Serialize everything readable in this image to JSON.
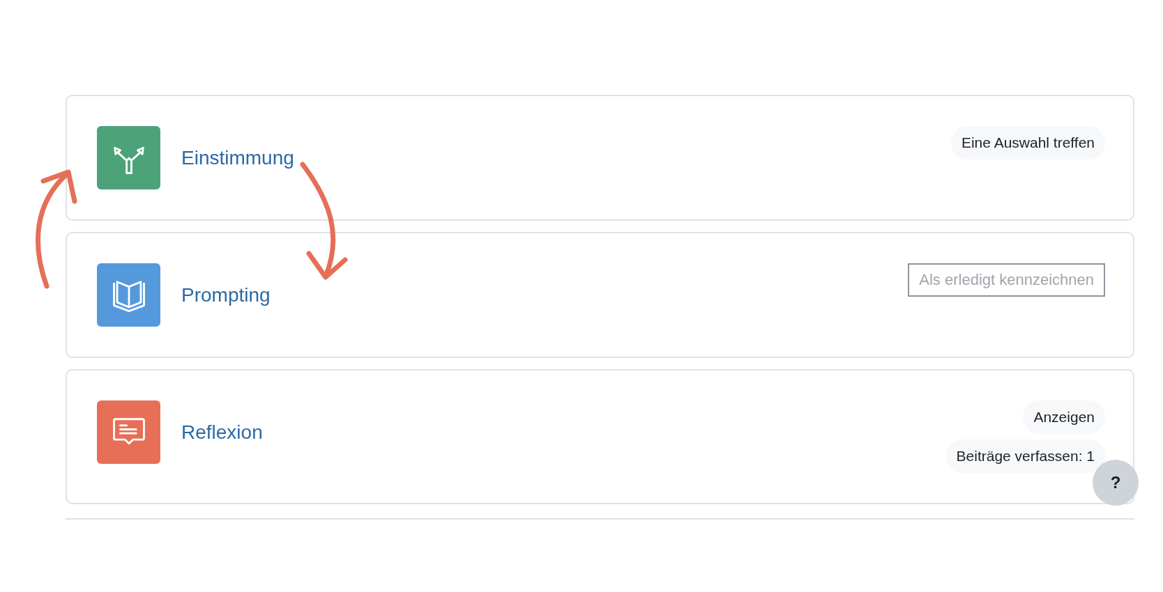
{
  "activities": [
    {
      "title": "Einstimmung",
      "kind": "choice",
      "color": "#4ca37a",
      "info": [
        {
          "kind": "pill",
          "text": "Eine Auswahl treffen"
        }
      ]
    },
    {
      "title": "Prompting",
      "kind": "book",
      "color": "#5599dd",
      "info": [
        {
          "kind": "button",
          "text": "Als erledigt kennzeichnen",
          "disabled": true
        }
      ]
    },
    {
      "title": "Reflexion",
      "kind": "forum",
      "color": "#e76f57",
      "info": [
        {
          "kind": "pill",
          "text": "Anzeigen"
        },
        {
          "kind": "pill",
          "text": "Beiträge verfassen: 1"
        }
      ]
    }
  ],
  "help_button": {
    "label": "?"
  }
}
